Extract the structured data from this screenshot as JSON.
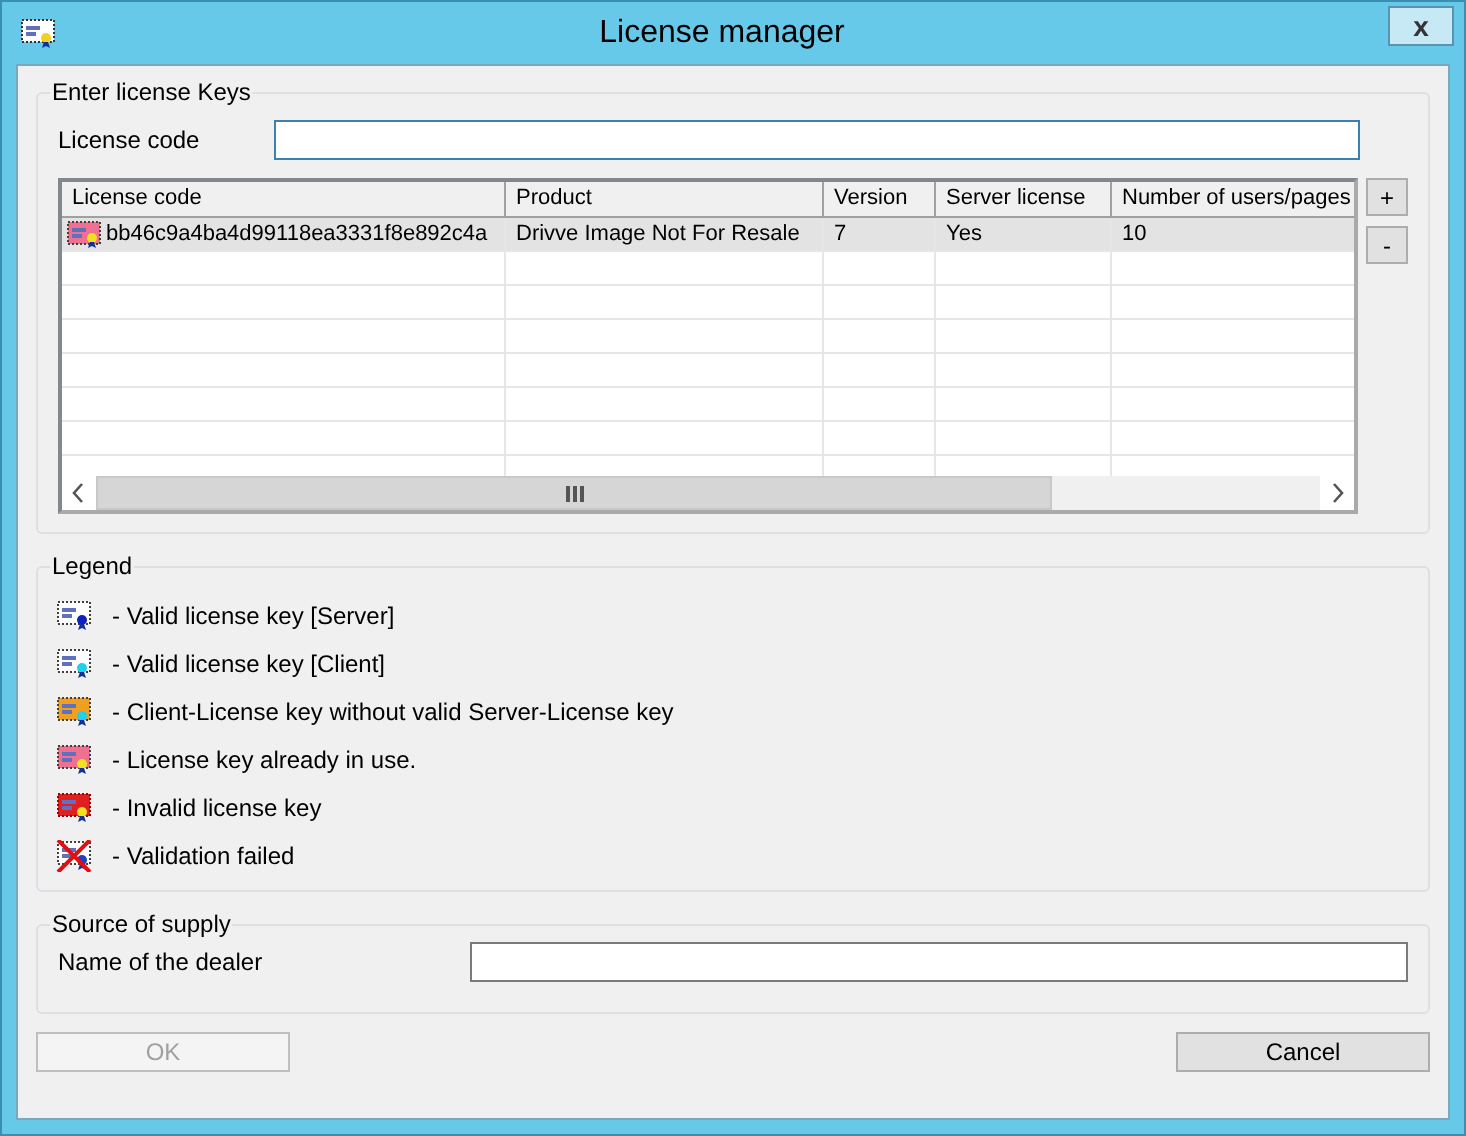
{
  "window": {
    "title": "License manager",
    "close": "x"
  },
  "enter_keys": {
    "title": "Enter license Keys",
    "label": "License code",
    "table": {
      "columns": [
        "License code",
        "Product",
        "Version",
        "Server license",
        "Number of users/pages"
      ],
      "rows": [
        {
          "kind": "in-use",
          "selected": true,
          "cells": [
            "bb46c9a4ba4d99118ea3331f8e892c4a",
            "Drivve Image Not For Resale",
            "7",
            "Yes",
            "10"
          ]
        }
      ]
    },
    "add_button": "+",
    "remove_button": "-"
  },
  "legend": {
    "title": "Legend",
    "items": [
      {
        "kind": "server",
        "text": "- Valid license key [Server]"
      },
      {
        "kind": "client",
        "text": "- Valid license key [Client]"
      },
      {
        "kind": "client-no-server",
        "text": "- Client-License key without valid Server-License key"
      },
      {
        "kind": "in-use",
        "text": "- License key already in use."
      },
      {
        "kind": "invalid",
        "text": "- Invalid license key"
      },
      {
        "kind": "failed",
        "text": "- Validation failed"
      }
    ]
  },
  "supply": {
    "title": "Source of supply",
    "label": "Name of the dealer"
  },
  "buttons": [
    {
      "label": "OK",
      "disabled": true
    },
    {
      "label": "Cancel",
      "disabled": false
    }
  ]
}
